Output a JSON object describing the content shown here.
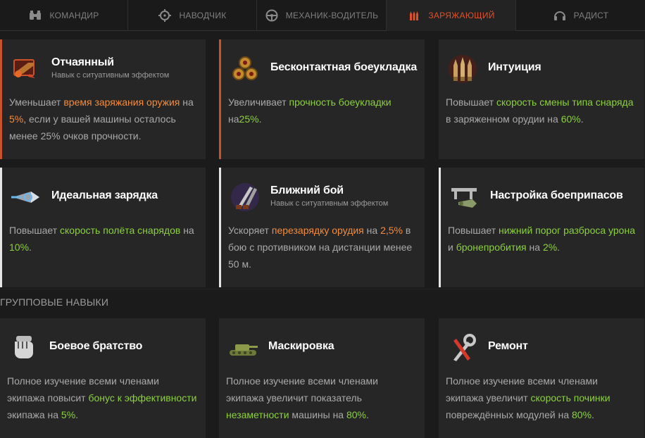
{
  "tabs": [
    {
      "label": "КОМАНДИР",
      "icon": "binoculars-icon",
      "active": false
    },
    {
      "label": "НАВОДЧИК",
      "icon": "crosshair-icon",
      "active": false
    },
    {
      "label": "МЕХАНИК-ВОДИТЕЛЬ",
      "icon": "steering-wheel-icon",
      "active": false
    },
    {
      "label": "ЗАРЯЖАЮЩИЙ",
      "icon": "shells-icon",
      "active": true
    },
    {
      "label": "РАДИСТ",
      "icon": "headphones-icon",
      "active": false
    }
  ],
  "colors": {
    "accent": "#e0502a",
    "highlight_orange": "#f58b3a",
    "highlight_green": "#8bd23c"
  },
  "skills": [
    {
      "title": "Отчаянный",
      "subtitle": "Навык с ситуативным эффектом",
      "icon": "desperate-shell-icon",
      "desc": [
        {
          "t": "Уменьшает "
        },
        {
          "t": "время заряжания оружия",
          "c": "o"
        },
        {
          "t": " на "
        },
        {
          "t": "5%",
          "c": "o"
        },
        {
          "t": ", если у вашей машины осталось менее 25% очков прочности."
        }
      ]
    },
    {
      "title": "Бесконтактная боеукладка",
      "subtitle": "",
      "icon": "ammo-rack-medals-icon",
      "desc": [
        {
          "t": "Увеличивает "
        },
        {
          "t": "прочность боеукладки",
          "c": "g"
        },
        {
          "t": " на"
        },
        {
          "t": "25%",
          "c": "g"
        },
        {
          "t": "."
        }
      ]
    },
    {
      "title": "Интуиция",
      "subtitle": "",
      "icon": "intuition-shells-icon",
      "desc": [
        {
          "t": "Повышает "
        },
        {
          "t": "скорость смены типа снаряда",
          "c": "g"
        },
        {
          "t": " в заряженном орудии на "
        },
        {
          "t": "60%",
          "c": "g"
        },
        {
          "t": "."
        }
      ]
    },
    {
      "title": "Идеальная зарядка",
      "subtitle": "",
      "icon": "perfect-charge-shell-icon",
      "desc": [
        {
          "t": "Повышает "
        },
        {
          "t": "скорость полёта снарядов",
          "c": "g"
        },
        {
          "t": " на "
        },
        {
          "t": "10%",
          "c": "g"
        },
        {
          "t": "."
        }
      ]
    },
    {
      "title": "Ближний бой",
      "subtitle": "Навык с ситуативным эффектом",
      "icon": "close-combat-knives-icon",
      "desc": [
        {
          "t": "Ускоряет "
        },
        {
          "t": "перезарядку орудия",
          "c": "o"
        },
        {
          "t": " на "
        },
        {
          "t": "2,5%",
          "c": "o"
        },
        {
          "t": " в бою с противником на дистанции менее 50 м."
        }
      ]
    },
    {
      "title": "Настройка боеприпасов",
      "subtitle": "",
      "icon": "ammo-tuning-caliper-icon",
      "desc": [
        {
          "t": "Повышает "
        },
        {
          "t": "нижний порог разброса урона",
          "c": "g"
        },
        {
          "t": " и "
        },
        {
          "t": "бронепробития",
          "c": "g"
        },
        {
          "t": " на "
        },
        {
          "t": "2%",
          "c": "g"
        },
        {
          "t": "."
        }
      ]
    }
  ],
  "group_section_title": "ГРУППОВЫЕ НАВЫКИ",
  "group_skills": [
    {
      "title": "Боевое братство",
      "icon": "brotherhood-fist-icon",
      "desc": [
        {
          "t": "Полное изучение всеми членами экипажа повысит "
        },
        {
          "t": "бонус к эффективности",
          "c": "g"
        },
        {
          "t": " экипажа на "
        },
        {
          "t": "5%",
          "c": "g"
        },
        {
          "t": "."
        }
      ]
    },
    {
      "title": "Маскировка",
      "icon": "camouflage-tank-icon",
      "desc": [
        {
          "t": "Полное изучение всеми членами экипажа увеличит показатель "
        },
        {
          "t": "незаметности",
          "c": "g"
        },
        {
          "t": " машины на "
        },
        {
          "t": "80%",
          "c": "g"
        },
        {
          "t": "."
        }
      ]
    },
    {
      "title": "Ремонт",
      "icon": "repair-wrench-icon",
      "desc": [
        {
          "t": "Полное изучение всеми членами экипажа увеличит "
        },
        {
          "t": "скорость починки",
          "c": "g"
        },
        {
          "t": " повреждённых модулей на "
        },
        {
          "t": "80%",
          "c": "g"
        },
        {
          "t": "."
        }
      ]
    }
  ]
}
